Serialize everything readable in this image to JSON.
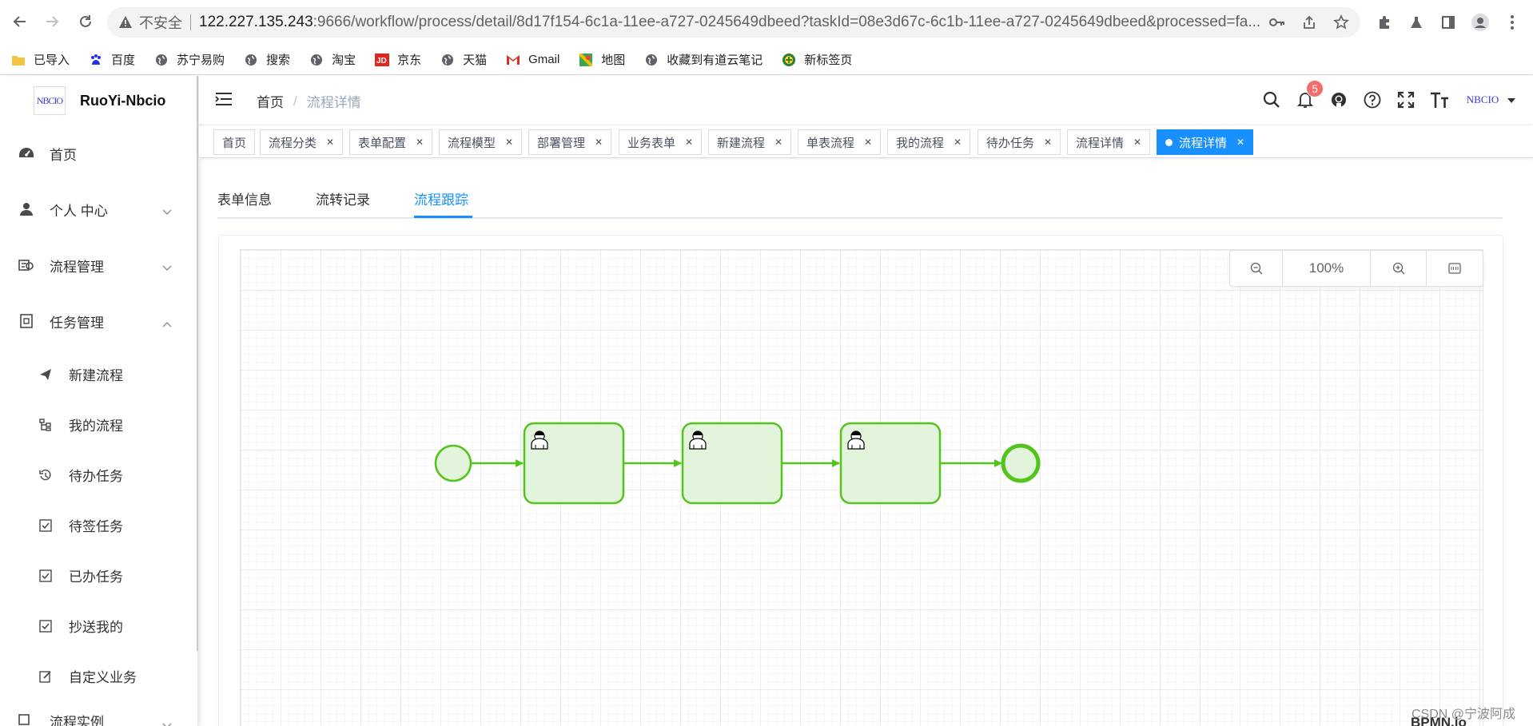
{
  "browser": {
    "insecure_label": "不安全",
    "url_host": "122.227.135.243",
    "url_rest": ":9666/workflow/process/detail/8d17f154-6c1a-11ee-a727-0245649dbeed?taskId=08e3d67c-6c1b-11ee-a727-0245649dbeed&processed=fa...",
    "bookmarks": [
      {
        "label": "已导入",
        "icon": "folder-icon"
      },
      {
        "label": "百度",
        "icon": "baidu-icon"
      },
      {
        "label": "苏宁易购",
        "icon": "globe-icon"
      },
      {
        "label": "搜索",
        "icon": "globe-icon"
      },
      {
        "label": "淘宝",
        "icon": "globe-icon"
      },
      {
        "label": "京东",
        "icon": "jd-icon"
      },
      {
        "label": "天猫",
        "icon": "globe-icon"
      },
      {
        "label": "Gmail",
        "icon": "gmail-icon"
      },
      {
        "label": "地图",
        "icon": "maps-icon"
      },
      {
        "label": "收藏到有道云笔记",
        "icon": "globe-icon"
      },
      {
        "label": "新标签页",
        "icon": "newtab-icon"
      }
    ]
  },
  "app": {
    "title": "RuoYi-Nbcio",
    "logo_text": "NBCIO",
    "avatar_text": "NBCIO",
    "notification_count": "5"
  },
  "sidebar": {
    "items": [
      {
        "label": "首页",
        "icon": "dashboard-icon"
      },
      {
        "label": "个人 中心",
        "icon": "user-icon"
      },
      {
        "label": "流程管理",
        "icon": "flow-icon"
      },
      {
        "label": "任务管理",
        "icon": "task-icon"
      }
    ],
    "sub_items": [
      {
        "label": "新建流程",
        "icon": "send-icon"
      },
      {
        "label": "我的流程",
        "icon": "tree-icon"
      },
      {
        "label": "待办任务",
        "icon": "clock-icon"
      },
      {
        "label": "待签任务",
        "icon": "checkbox-icon"
      },
      {
        "label": "已办任务",
        "icon": "checkbox-icon"
      },
      {
        "label": "抄送我的",
        "icon": "checkbox-icon"
      },
      {
        "label": "自定义业务",
        "icon": "edit-icon"
      }
    ],
    "partial_item": "流程实例"
  },
  "breadcrumb": {
    "home": "首页",
    "current": "流程详情"
  },
  "tags": [
    {
      "label": "首页"
    },
    {
      "label": "流程分类"
    },
    {
      "label": "表单配置"
    },
    {
      "label": "流程模型"
    },
    {
      "label": "部署管理"
    },
    {
      "label": "业务表单"
    },
    {
      "label": "新建流程"
    },
    {
      "label": "单表流程"
    },
    {
      "label": "我的流程"
    },
    {
      "label": "待办任务"
    },
    {
      "label": "流程详情"
    },
    {
      "label": "流程详情"
    }
  ],
  "tabs": [
    {
      "label": "表单信息"
    },
    {
      "label": "流转记录"
    },
    {
      "label": "流程跟踪"
    }
  ],
  "viewer": {
    "zoom": "100%",
    "flow_color": "#52c41a",
    "task_fill": "#e3f4dc",
    "footer": "BPMN.io"
  },
  "watermark": "CSDN @宁波阿成"
}
